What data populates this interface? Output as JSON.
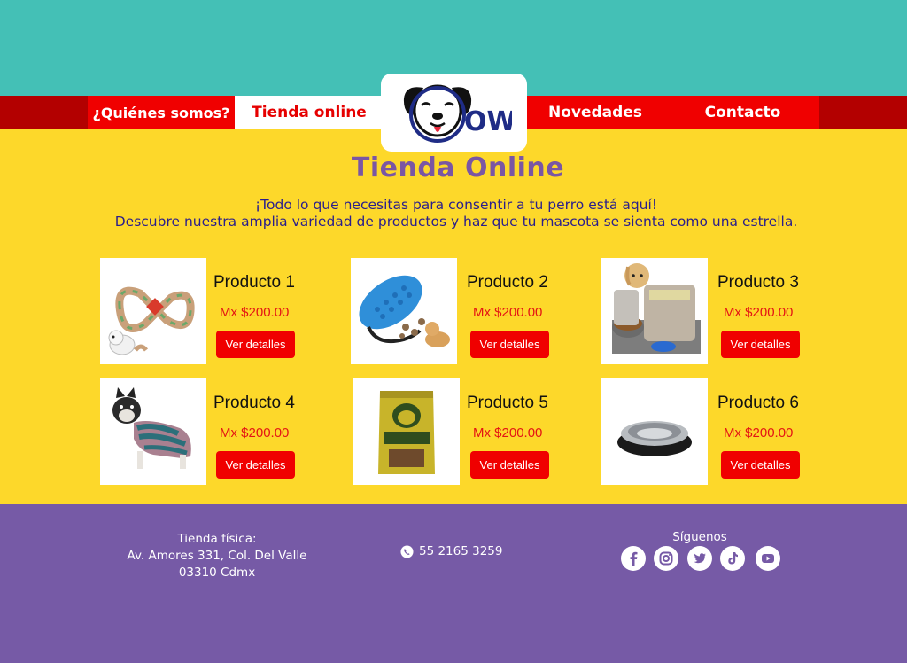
{
  "nav": {
    "quienes": "¿Quiénes somos?",
    "tienda": "Tienda online",
    "novedades": "Novedades",
    "contacto": "Contacto",
    "logo_text": "OW"
  },
  "main": {
    "title": "Tienda Online",
    "intro_line1": "¡Todo lo que necesitas para consentir a tu perro está aquí!",
    "intro_line2": "Descubre nuestra amplia variedad de productos y haz que tu mascota se sienta como una estrella."
  },
  "products": [
    {
      "name": "Producto 1",
      "price": "Mx $200.00",
      "button": "Ver detalles",
      "icon": "rope-toy-icon"
    },
    {
      "name": "Producto 2",
      "price": "Mx $200.00",
      "button": "Ver detalles",
      "icon": "ball-toy-icon"
    },
    {
      "name": "Producto 3",
      "price": "Mx $200.00",
      "button": "Ver detalles",
      "icon": "travel-bag-icon"
    },
    {
      "name": "Producto 4",
      "price": "Mx $200.00",
      "button": "Ver detalles",
      "icon": "dog-sweater-icon"
    },
    {
      "name": "Producto 5",
      "price": "Mx $200.00",
      "button": "Ver detalles",
      "icon": "treat-bag-icon"
    },
    {
      "name": "Producto 6",
      "price": "Mx $200.00",
      "button": "Ver detalles",
      "icon": "food-bowl-icon"
    }
  ],
  "footer": {
    "store_label": "Tienda física:",
    "address_line1": "Av. Amores 331, Col. Del Valle",
    "address_line2": "03310 Cdmx",
    "phone": "55 2165 3259",
    "follow_label": "Síguenos",
    "social": [
      "facebook-icon",
      "instagram-icon",
      "twitter-icon",
      "tiktok-icon",
      "youtube-icon"
    ]
  },
  "colors": {
    "top_band": "#44c0b6",
    "nav_red": "#f00000",
    "background": "#fdd82a",
    "footer": "#765aa6",
    "title": "#7a56a4"
  }
}
